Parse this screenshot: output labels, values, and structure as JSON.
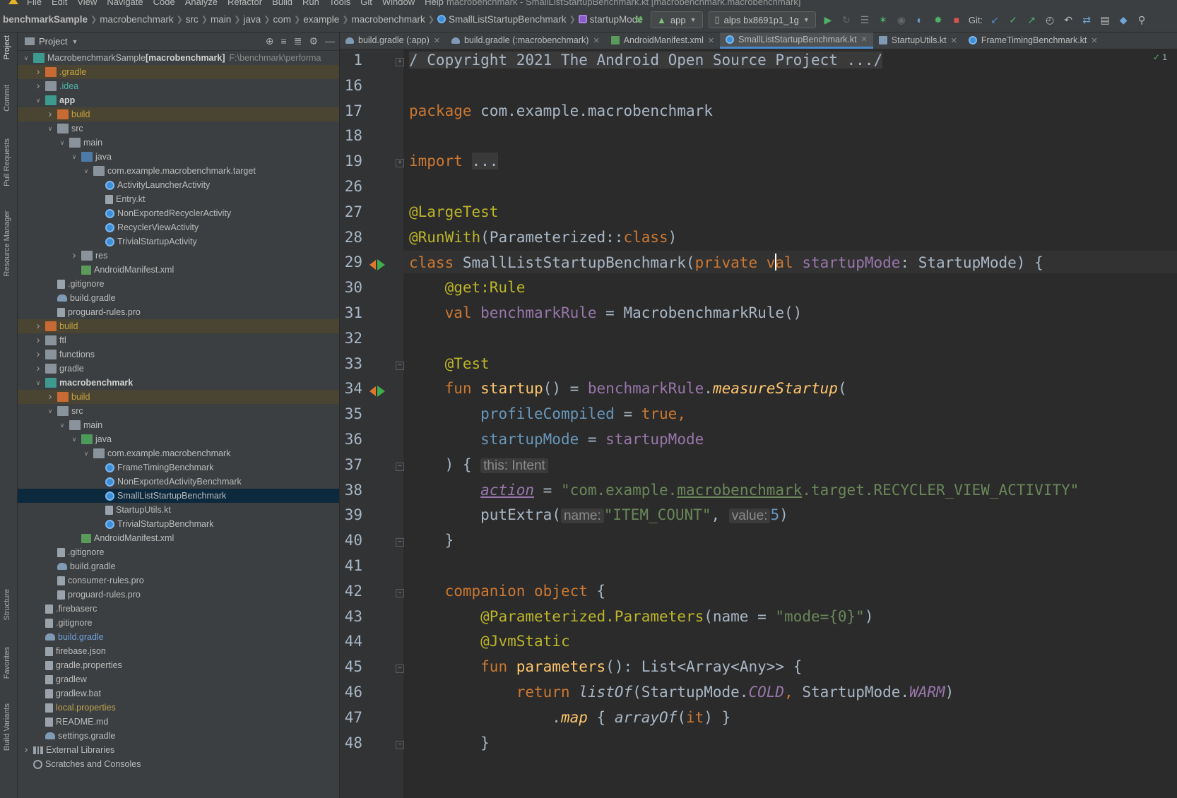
{
  "window": {
    "title": "macrobenchmark - SmallListStartupBenchmark.kt [macrobenchmark.macrobenchmark]",
    "menu": [
      "File",
      "Edit",
      "View",
      "Navigate",
      "Code",
      "Analyze",
      "Refactor",
      "Build",
      "Run",
      "Tools",
      "Git",
      "Window",
      "Help"
    ]
  },
  "breadcrumb": [
    "benchmarkSample",
    "macrobenchmark",
    "src",
    "main",
    "java",
    "com",
    "example",
    "macrobenchmark",
    "SmallListStartupBenchmark",
    "startupMode"
  ],
  "toolbar": {
    "run_config": "app",
    "device": "alps bx8691p1_1g",
    "git_label": "Git:"
  },
  "left_strip": [
    "Project",
    "Commit",
    "Pull Requests",
    "Resource Manager",
    "Structure",
    "Favorites",
    "Build Variants"
  ],
  "project_panel": {
    "title": "Project",
    "tree": [
      {
        "depth": 0,
        "arrow": "open",
        "icon": "folder teal",
        "label": "MacrobenchmarkSample",
        "bold_suffix": " [macrobenchmark]",
        "path": "F:\\benchmark\\performa"
      },
      {
        "depth": 1,
        "arrow": "closed",
        "icon": "folder orange",
        "label": ".gradle",
        "style": "orange",
        "hl": true
      },
      {
        "depth": 1,
        "arrow": "closed",
        "icon": "folder",
        "label": ".idea",
        "style": "teal"
      },
      {
        "depth": 1,
        "arrow": "open",
        "icon": "folder teal",
        "label": "app",
        "style": "bold"
      },
      {
        "depth": 2,
        "arrow": "closed",
        "icon": "folder orange",
        "label": "build",
        "style": "orange",
        "hl": true
      },
      {
        "depth": 2,
        "arrow": "open",
        "icon": "folder",
        "label": "src"
      },
      {
        "depth": 3,
        "arrow": "open",
        "icon": "folder",
        "label": "main"
      },
      {
        "depth": 4,
        "arrow": "open",
        "icon": "folder blue",
        "label": "java"
      },
      {
        "depth": 5,
        "arrow": "open",
        "icon": "folder",
        "label": "com.example.macrobenchmark.target"
      },
      {
        "depth": 6,
        "arrow": "",
        "icon": "cls",
        "label": "ActivityLauncherActivity"
      },
      {
        "depth": 6,
        "arrow": "",
        "icon": "file",
        "label": "Entry.kt"
      },
      {
        "depth": 6,
        "arrow": "",
        "icon": "cls",
        "label": "NonExportedRecyclerActivity"
      },
      {
        "depth": 6,
        "arrow": "",
        "icon": "cls",
        "label": "RecyclerViewActivity"
      },
      {
        "depth": 6,
        "arrow": "",
        "icon": "cls",
        "label": "TrivialStartupActivity"
      },
      {
        "depth": 4,
        "arrow": "closed",
        "icon": "folder",
        "label": "res"
      },
      {
        "depth": 4,
        "arrow": "",
        "icon": "xml",
        "label": "AndroidManifest.xml"
      },
      {
        "depth": 2,
        "arrow": "",
        "icon": "file",
        "label": ".gitignore"
      },
      {
        "depth": 2,
        "arrow": "",
        "icon": "gradle",
        "label": "build.gradle"
      },
      {
        "depth": 2,
        "arrow": "",
        "icon": "file",
        "label": "proguard-rules.pro"
      },
      {
        "depth": 1,
        "arrow": "closed",
        "icon": "folder orange",
        "label": "build",
        "style": "orange",
        "hl": true
      },
      {
        "depth": 1,
        "arrow": "closed",
        "icon": "folder",
        "label": "ftl"
      },
      {
        "depth": 1,
        "arrow": "closed",
        "icon": "folder",
        "label": "functions"
      },
      {
        "depth": 1,
        "arrow": "closed",
        "icon": "folder",
        "label": "gradle"
      },
      {
        "depth": 1,
        "arrow": "open",
        "icon": "folder teal",
        "label": "macrobenchmark",
        "style": "bold"
      },
      {
        "depth": 2,
        "arrow": "closed",
        "icon": "folder orange",
        "label": "build",
        "style": "orange",
        "hl": true
      },
      {
        "depth": 2,
        "arrow": "open",
        "icon": "folder",
        "label": "src"
      },
      {
        "depth": 3,
        "arrow": "open",
        "icon": "folder",
        "label": "main"
      },
      {
        "depth": 4,
        "arrow": "open",
        "icon": "folder green",
        "label": "java"
      },
      {
        "depth": 5,
        "arrow": "open",
        "icon": "folder",
        "label": "com.example.macrobenchmark"
      },
      {
        "depth": 6,
        "arrow": "",
        "icon": "cls",
        "label": "FrameTimingBenchmark"
      },
      {
        "depth": 6,
        "arrow": "",
        "icon": "cls",
        "label": "NonExportedActivityBenchmark"
      },
      {
        "depth": 6,
        "arrow": "",
        "icon": "cls",
        "label": "SmallListStartupBenchmark",
        "sel": true
      },
      {
        "depth": 6,
        "arrow": "",
        "icon": "file",
        "label": "StartupUtils.kt"
      },
      {
        "depth": 6,
        "arrow": "",
        "icon": "cls",
        "label": "TrivialStartupBenchmark"
      },
      {
        "depth": 4,
        "arrow": "",
        "icon": "xml",
        "label": "AndroidManifest.xml"
      },
      {
        "depth": 2,
        "arrow": "",
        "icon": "file",
        "label": ".gitignore"
      },
      {
        "depth": 2,
        "arrow": "",
        "icon": "gradle",
        "label": "build.gradle"
      },
      {
        "depth": 2,
        "arrow": "",
        "icon": "file",
        "label": "consumer-rules.pro"
      },
      {
        "depth": 2,
        "arrow": "",
        "icon": "file",
        "label": "proguard-rules.pro"
      },
      {
        "depth": 1,
        "arrow": "",
        "icon": "file",
        "label": ".firebaserc"
      },
      {
        "depth": 1,
        "arrow": "",
        "icon": "file",
        "label": ".gitignore"
      },
      {
        "depth": 1,
        "arrow": "",
        "icon": "gradle",
        "label": "build.gradle",
        "style": "blue"
      },
      {
        "depth": 1,
        "arrow": "",
        "icon": "file",
        "label": "firebase.json"
      },
      {
        "depth": 1,
        "arrow": "",
        "icon": "file",
        "label": "gradle.properties"
      },
      {
        "depth": 1,
        "arrow": "",
        "icon": "file",
        "label": "gradlew"
      },
      {
        "depth": 1,
        "arrow": "",
        "icon": "file",
        "label": "gradlew.bat"
      },
      {
        "depth": 1,
        "arrow": "",
        "icon": "file",
        "label": "local.properties",
        "style": "yellow"
      },
      {
        "depth": 1,
        "arrow": "",
        "icon": "file",
        "label": "README.md"
      },
      {
        "depth": 1,
        "arrow": "",
        "icon": "gradle",
        "label": "settings.gradle"
      },
      {
        "depth": 0,
        "arrow": "closed",
        "icon": "lib",
        "label": "External Libraries"
      },
      {
        "depth": 0,
        "arrow": "",
        "icon": "scratch",
        "label": "Scratches and Consoles"
      }
    ]
  },
  "tabs": [
    {
      "label": "build.gradle (:app)",
      "icon": "g"
    },
    {
      "label": "build.gradle (:macrobenchmark)",
      "icon": "g"
    },
    {
      "label": "AndroidManifest.xml",
      "icon": "x"
    },
    {
      "label": "SmallListStartupBenchmark.kt",
      "icon": "c",
      "active": true
    },
    {
      "label": "StartupUtils.kt",
      "icon": "f"
    },
    {
      "label": "FrameTimingBenchmark.kt",
      "icon": "c"
    }
  ],
  "editor": {
    "inspection_count": "1",
    "lines": [
      {
        "n": "1",
        "fold": "+",
        "html": "<span class=\"c fold-box\">/ Copyright 2021 The Android Open Source Project .../</span>"
      },
      {
        "n": "16",
        "html": ""
      },
      {
        "n": "17",
        "html": "<span class=\"k\">package </span>com.example.macrobenchmark"
      },
      {
        "n": "18",
        "html": ""
      },
      {
        "n": "19",
        "fold": "+",
        "html": "<span class=\"k\">import </span><span class=\"fold-box\">...</span>"
      },
      {
        "n": "26",
        "html": ""
      },
      {
        "n": "27",
        "html": "<span class=\"a\">@LargeTest</span>"
      },
      {
        "n": "28",
        "html": "<span class=\"a\">@RunWith</span>(Parameterized::<span class=\"k\">class</span>)"
      },
      {
        "n": "29",
        "run": true,
        "html": "<span class=\"k\">class </span>SmallListStartupBenchmark(<span class=\"k\">private </span><span class=\"k\">v<span class=\"cursor\"></span>al </span><span class=\"p\">startupMode</span>: StartupMode) {"
      },
      {
        "n": "30",
        "html": "    <span class=\"a\">@get:Rule</span>"
      },
      {
        "n": "31",
        "html": "    <span class=\"k\">val </span><span class=\"p\">benchmarkRule </span>= MacrobenchmarkRule()"
      },
      {
        "n": "32",
        "html": ""
      },
      {
        "n": "33",
        "fold": "-",
        "html": "    <span class=\"a\">@Test</span>"
      },
      {
        "n": "34",
        "run": true,
        "html": "    <span class=\"k\">fun </span><span class=\"f\">startup</span>() = <span class=\"p\">benchmarkRule</span>.<span class=\"f i\">measureStartup</span>("
      },
      {
        "n": "35",
        "html": "        <span class=\"n\">profileCompiled </span>= <span class=\"k\">true,</span>"
      },
      {
        "n": "36",
        "html": "        <span class=\"n\">startupMode </span>= <span class=\"p\">startupMode</span>"
      },
      {
        "n": "37",
        "fold": "-",
        "html": "    ) { <span class=\"hint\">this: Intent</span>"
      },
      {
        "n": "38",
        "html": "        <span class=\"it-p u\">action</span> = <span class=\"s\">\"com.example.<span class=\"u\">macrobenchmark</span>.target.RECYCLER_VIEW_ACTIVITY\"</span>"
      },
      {
        "n": "39",
        "html": "        putExtra(<span class=\"hint\">name:</span><span class=\"s\">\"ITEM_COUNT\"</span>, <span class=\"hint\">value:</span><span class=\"n\">5</span>)"
      },
      {
        "n": "40",
        "fold": "-",
        "html": "    }"
      },
      {
        "n": "41",
        "html": ""
      },
      {
        "n": "42",
        "fold": "-",
        "html": "    <span class=\"k\">companion object </span>{"
      },
      {
        "n": "43",
        "html": "        <span class=\"a\">@Parameterized.Parameters</span>(name = <span class=\"s\">\"mode={0}\"</span>)"
      },
      {
        "n": "44",
        "html": "        <span class=\"a\">@JvmStatic</span>"
      },
      {
        "n": "45",
        "fold": "-",
        "html": "        <span class=\"k\">fun </span><span class=\"f\">parameters</span>(): List&lt;Array&lt;Any&gt;&gt; {"
      },
      {
        "n": "46",
        "html": "            <span class=\"k\">return </span><span class=\"i\">listOf</span>(StartupMode.<span class=\"it-p\">COLD</span><span class=\"k\">, </span>StartupMode.<span class=\"it-p\">WARM</span>)"
      },
      {
        "n": "47",
        "html": "                .<span class=\"f i\">map </span>{ <span class=\"i\">arrayOf</span>(<span class=\"k\">it</span>) }"
      },
      {
        "n": "48",
        "fold": "-",
        "html": "        }"
      }
    ]
  }
}
